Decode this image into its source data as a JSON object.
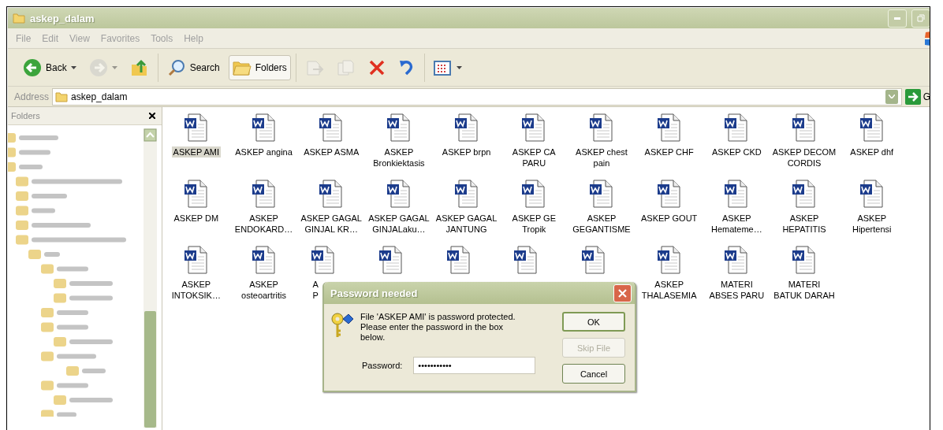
{
  "window": {
    "title": "askep_dalam"
  },
  "menu": [
    "File",
    "Edit",
    "View",
    "Favorites",
    "Tools",
    "Help"
  ],
  "toolbar": [
    [
      {
        "kind": "back",
        "label": "Back",
        "disabled": false,
        "pressed": false
      },
      {
        "kind": "forward",
        "disabled": true,
        "pressed": false
      },
      {
        "kind": "up",
        "disabled": false,
        "pressed": false
      }
    ],
    [
      {
        "kind": "search",
        "label": "Search",
        "disabled": false,
        "pressed": false
      },
      {
        "kind": "folders",
        "label": "Folders",
        "disabled": false,
        "pressed": true
      }
    ],
    [
      {
        "kind": "move",
        "disabled": true,
        "pressed": false
      },
      {
        "kind": "copy",
        "disabled": true,
        "pressed": false
      },
      {
        "kind": "delete",
        "disabled": false,
        "pressed": false
      },
      {
        "kind": "undo",
        "disabled": false,
        "pressed": false
      }
    ],
    [
      {
        "kind": "views",
        "disabled": false,
        "pressed": false
      }
    ]
  ],
  "address": {
    "label": "Address",
    "value": "askep_dalam",
    "go_label": "G"
  },
  "folders_pane": {
    "title": "Folders"
  },
  "files": [
    {
      "lines": [
        "ASKEP AMI"
      ],
      "selected": true,
      "covered": false
    },
    {
      "lines": [
        "ASKEP angina"
      ],
      "selected": false,
      "covered": false
    },
    {
      "lines": [
        "ASKEP ASMA"
      ],
      "selected": false,
      "covered": false
    },
    {
      "lines": [
        "ASKEP",
        "Bronkiektasis"
      ],
      "selected": false,
      "covered": false
    },
    {
      "lines": [
        "ASKEP brpn"
      ],
      "selected": false,
      "covered": false
    },
    {
      "lines": [
        "ASKEP CA",
        "PARU"
      ],
      "selected": false,
      "covered": false
    },
    {
      "lines": [
        "ASKEP chest",
        "pain"
      ],
      "selected": false,
      "covered": false
    },
    {
      "lines": [
        "ASKEP CHF"
      ],
      "selected": false,
      "covered": false
    },
    {
      "lines": [
        "ASKEP CKD"
      ],
      "selected": false,
      "covered": false
    },
    {
      "lines": [
        "ASKEP DECOM",
        "CORDIS"
      ],
      "selected": false,
      "covered": false
    },
    {
      "lines": [
        "ASKEP dhf"
      ],
      "selected": false,
      "covered": false
    },
    {
      "lines": [
        "ASKEP DM"
      ],
      "selected": false,
      "covered": false
    },
    {
      "lines": [
        "ASKEP",
        "ENDOKARD…"
      ],
      "selected": false,
      "covered": false
    },
    {
      "lines": [
        "ASKEP GAGAL",
        "GINJAL KR…"
      ],
      "selected": false,
      "covered": false
    },
    {
      "lines": [
        "ASKEP GAGAL",
        "GINJALaku…"
      ],
      "selected": false,
      "covered": false
    },
    {
      "lines": [
        "ASKEP GAGAL",
        "JANTUNG"
      ],
      "selected": false,
      "covered": false
    },
    {
      "lines": [
        "ASKEP GE",
        "Tropik"
      ],
      "selected": false,
      "covered": false
    },
    {
      "lines": [
        "ASKEP",
        "GEGANTISME"
      ],
      "selected": false,
      "covered": false
    },
    {
      "lines": [
        "ASKEP GOUT"
      ],
      "selected": false,
      "covered": false
    },
    {
      "lines": [
        "ASKEP",
        "Hemateme…"
      ],
      "selected": false,
      "covered": false
    },
    {
      "lines": [
        "ASKEP",
        "HEPATITIS"
      ],
      "selected": false,
      "covered": false
    },
    {
      "lines": [
        "ASKEP",
        "Hipertensi"
      ],
      "selected": false,
      "covered": false
    },
    {
      "lines": [
        "ASKEP",
        "INTOKSIK…"
      ],
      "selected": false,
      "covered": false
    },
    {
      "lines": [
        "ASKEP",
        "osteoartritis"
      ],
      "selected": false,
      "covered": false
    },
    {
      "lines": [
        "A",
        "P"
      ],
      "selected": false,
      "covered": true
    },
    {
      "covered": true
    },
    {
      "covered": true
    },
    {
      "covered": true
    },
    {
      "covered": true
    },
    {
      "lines": [
        "ASKEP",
        "THALASEMIA"
      ],
      "selected": false,
      "covered": false
    },
    {
      "lines": [
        "MATERI",
        "ABSES PARU"
      ],
      "selected": false,
      "covered": false
    },
    {
      "lines": [
        "MATERI",
        "BATUK DARAH"
      ],
      "selected": false,
      "covered": false
    }
  ],
  "dialog": {
    "title": "Password needed",
    "message": "File 'ASKEP AMI' is password protected. Please enter the password in the box below.",
    "password_label": "Password:",
    "password_value": "•••••••••••",
    "buttons": [
      {
        "label": "OK",
        "disabled": false,
        "default": true
      },
      {
        "label": "Skip File",
        "disabled": true,
        "default": false
      },
      {
        "label": "Cancel",
        "disabled": false,
        "default": false
      }
    ]
  }
}
